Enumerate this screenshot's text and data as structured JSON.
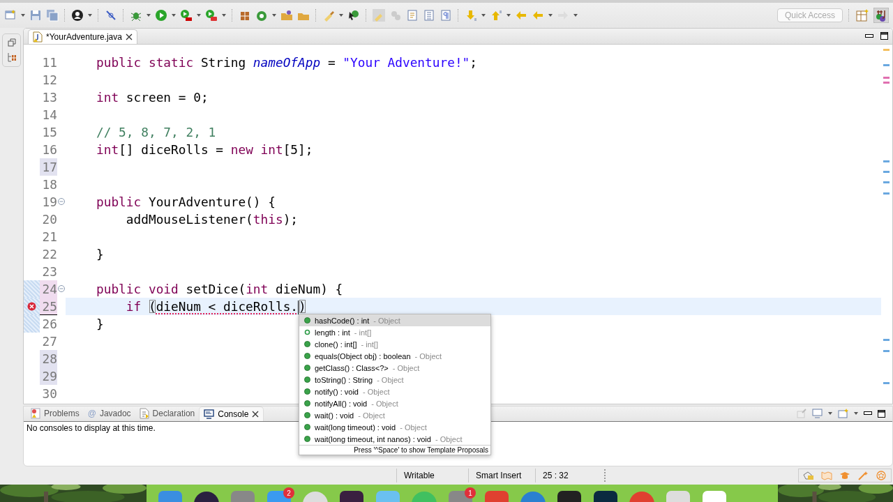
{
  "toolbar": {
    "quick_access": {
      "placeholder": "Quick Access"
    }
  },
  "editor": {
    "tab": {
      "title": "*YourAdventure.java",
      "selected": true
    },
    "lines": [
      {
        "number": "11",
        "changed": false,
        "tokens": [
          {
            "kind": "keyword",
            "text": "public static"
          },
          {
            "kind": "text",
            "text": " String "
          },
          {
            "kind": "field",
            "text": "nameOfApp"
          },
          {
            "kind": "text",
            "text": " = "
          },
          {
            "kind": "string",
            "text": "\"Your Adventure!\""
          },
          {
            "kind": "text",
            "text": ";"
          }
        ]
      },
      {
        "number": "12",
        "changed": false
      },
      {
        "number": "13",
        "changed": false,
        "tokens": [
          {
            "kind": "keyword",
            "text": "int"
          },
          {
            "kind": "text",
            "text": " screen = 0;"
          }
        ]
      },
      {
        "number": "14",
        "changed": false
      },
      {
        "number": "15",
        "changed": false,
        "tokens": [
          {
            "kind": "comment",
            "text": "// 5, 8, 7, 2, 1"
          }
        ]
      },
      {
        "number": "16",
        "changed": false,
        "tokens": [
          {
            "kind": "keyword",
            "text": "int"
          },
          {
            "kind": "text",
            "text": "[] diceRolls = "
          },
          {
            "kind": "keyword",
            "text": "new int"
          },
          {
            "kind": "text",
            "text": "[5];"
          }
        ]
      },
      {
        "number": "17",
        "changed": true
      },
      {
        "number": "18",
        "changed": false
      },
      {
        "number": "19",
        "changed": false,
        "fold": true,
        "tokens": [
          {
            "kind": "keyword",
            "text": "public"
          },
          {
            "kind": "text",
            "text": " YourAdventure() {"
          }
        ]
      },
      {
        "number": "20",
        "changed": false,
        "tokens": [
          {
            "kind": "text",
            "text": "    addMouseListener("
          },
          {
            "kind": "keyword",
            "text": "this"
          },
          {
            "kind": "text",
            "text": ");"
          }
        ]
      },
      {
        "number": "21",
        "changed": false
      },
      {
        "number": "22",
        "changed": false,
        "tokens": [
          {
            "kind": "text",
            "text": "}"
          }
        ]
      },
      {
        "number": "23",
        "changed": false
      },
      {
        "number": "24",
        "changed": true,
        "fold": true,
        "scope": true,
        "tokens": [
          {
            "kind": "keyword",
            "text": "public void"
          },
          {
            "kind": "text",
            "text": " setDice("
          },
          {
            "kind": "keyword",
            "text": "int"
          },
          {
            "kind": "text",
            "text": " dieNum) {"
          }
        ]
      },
      {
        "number": "25",
        "changed": true,
        "scope": true,
        "error": true,
        "current": true,
        "tokens": [
          {
            "kind": "keyword",
            "text": "    if "
          },
          {
            "kind": "bracket",
            "text": "("
          },
          {
            "kind": "error",
            "text": "dieNum < diceRolls."
          },
          {
            "kind": "bracket",
            "text": ")"
          }
        ]
      },
      {
        "number": "26",
        "changed": false,
        "scope": true,
        "tokens": [
          {
            "kind": "text",
            "text": "}"
          }
        ]
      },
      {
        "number": "27",
        "changed": false
      },
      {
        "number": "28",
        "changed": true
      },
      {
        "number": "29",
        "changed": true
      },
      {
        "number": "30",
        "changed": false
      }
    ]
  },
  "completion": {
    "items": [
      {
        "kind": "method",
        "signature": "hashCode() : int",
        "owner": "- Object",
        "selected": true
      },
      {
        "kind": "field",
        "signature": "length : int",
        "owner": "- int[]",
        "selected": false
      },
      {
        "kind": "method",
        "signature": "clone() : int[]",
        "owner": "- int[]",
        "selected": false
      },
      {
        "kind": "method",
        "signature": "equals(Object obj) : boolean",
        "owner": "- Object",
        "selected": false
      },
      {
        "kind": "method",
        "signature": "getClass() : Class<?>",
        "owner": "- Object",
        "selected": false
      },
      {
        "kind": "method",
        "signature": "toString() : String",
        "owner": "- Object",
        "selected": false
      },
      {
        "kind": "method",
        "signature": "notify() : void",
        "owner": "- Object",
        "selected": false
      },
      {
        "kind": "method",
        "signature": "notifyAll() : void",
        "owner": "- Object",
        "selected": false
      },
      {
        "kind": "method",
        "signature": "wait() : void",
        "owner": "- Object",
        "selected": false
      },
      {
        "kind": "method",
        "signature": "wait(long timeout) : void",
        "owner": "- Object",
        "selected": false
      },
      {
        "kind": "method",
        "signature": "wait(long timeout, int nanos) : void",
        "owner": "- Object",
        "selected": false
      }
    ],
    "footer": "Press '^Space' to show Template Proposals"
  },
  "panel": {
    "tabs": [
      {
        "kind": "problems",
        "label": "Problems",
        "selected": false
      },
      {
        "kind": "javadoc",
        "icon": "@",
        "label": "Javadoc",
        "selected": false
      },
      {
        "kind": "declaration",
        "label": "Declaration",
        "selected": false
      },
      {
        "kind": "console",
        "label": "Console",
        "selected": true
      }
    ],
    "message": "No consoles to display at this time."
  },
  "status_bar": {
    "mode": "Writable",
    "insert": "Smart Insert",
    "position": "25 : 32"
  },
  "dock": {
    "badges": [
      "2",
      "1"
    ]
  }
}
